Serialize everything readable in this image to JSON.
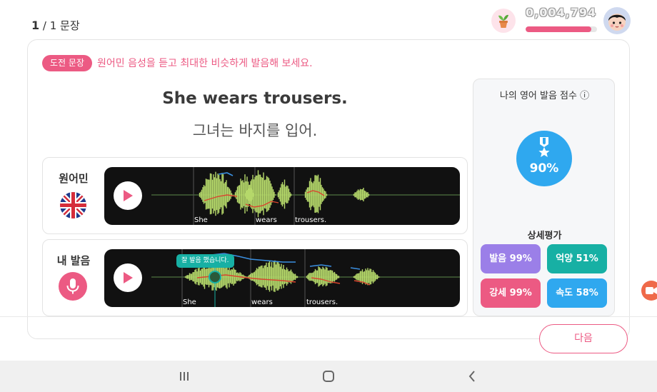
{
  "progress": {
    "current": "1",
    "rest": " / 1 문장"
  },
  "user": {
    "points": "0,004,794",
    "points_progress": 0.92
  },
  "challenge": {
    "tag": "도전 문장",
    "instruction": "원어민 음성을 듣고 최대한 비슷하게 발음해 보세요."
  },
  "sentence": {
    "english": "She wears trousers.",
    "korean": "그녀는 바지를 입어."
  },
  "native_row": {
    "label": "원어민",
    "words": [
      "She",
      "wears",
      "trousers."
    ]
  },
  "my_row": {
    "label": "내 발음",
    "words": [
      "She",
      "wears",
      "trousers."
    ],
    "tooltip": "잘 발음 했습니다."
  },
  "score": {
    "title": "나의 영어 발음 점수 ⓘ",
    "overall": "90%",
    "detail_title": "상세평가",
    "chips": [
      {
        "label": "발음 99%",
        "color": "#9b7fe8"
      },
      {
        "label": "억양 51%",
        "color": "#17b0a4"
      },
      {
        "label": "강세 99%",
        "color": "#ec5a83"
      },
      {
        "label": "속도 58%",
        "color": "#2fa8ef"
      }
    ]
  },
  "next_button": "다음",
  "colors": {
    "accent": "#ec5a83",
    "waveform": "#b5d86a",
    "pitch": "#d9452f",
    "reference": "#3b8fe0"
  },
  "icons": [
    "plant-icon",
    "avatar-icon",
    "uk-flag-icon",
    "mic-icon",
    "play-icon",
    "medal-icon",
    "recents-icon",
    "home-icon",
    "back-icon"
  ]
}
